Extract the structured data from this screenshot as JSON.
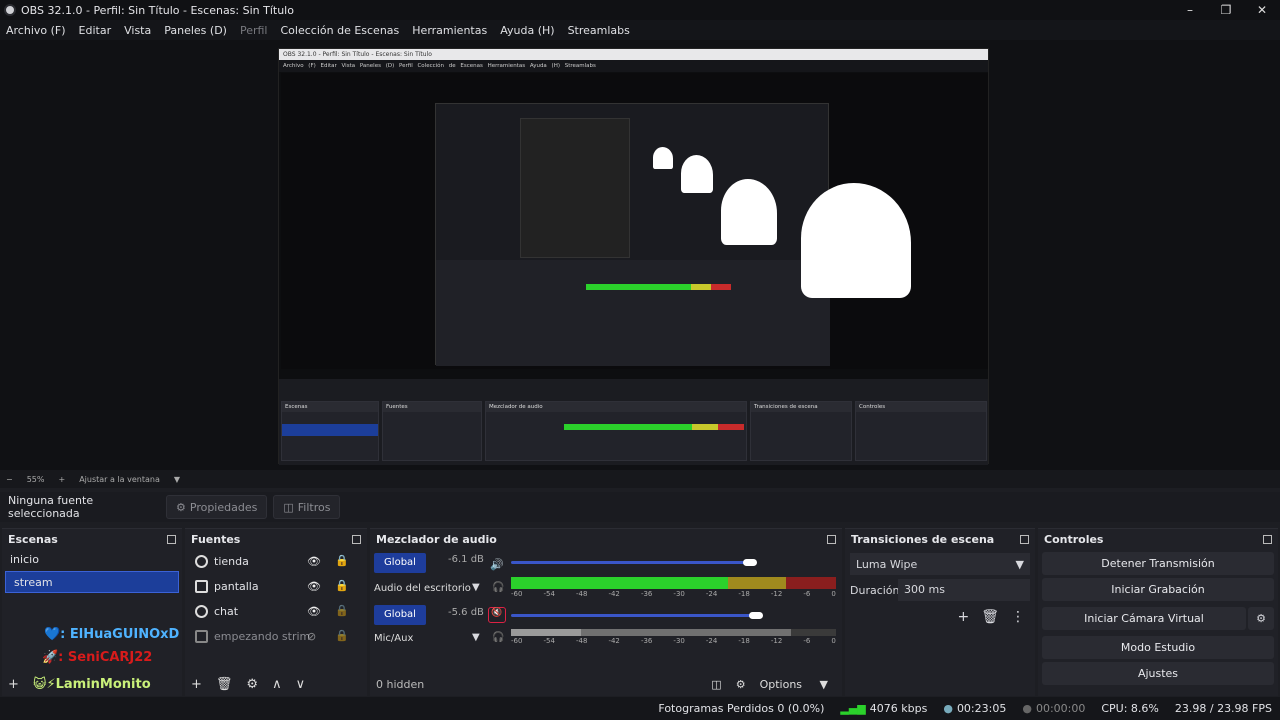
{
  "window": {
    "title": "OBS 32.1.0 - Perfil: Sin Título - Escenas: Sin Título",
    "minimize": "–",
    "maximize": "❐",
    "close": "✕"
  },
  "menu": [
    "Archivo (F)",
    "Editar",
    "Vista",
    "Paneles (D)",
    "Perfil",
    "Colección de Escenas",
    "Herramientas",
    "Ayuda (H)",
    "Streamlabs"
  ],
  "zoom": {
    "minus": "−",
    "value": "55%",
    "plus": "+",
    "fit_label": "Ajustar a la ventana"
  },
  "source_bar": {
    "no_selection": "Ninguna fuente seleccionada",
    "properties": "Propiedades",
    "filters": "Filtros"
  },
  "scenes": {
    "title": "Escenas",
    "items": [
      "inicio",
      "stream"
    ],
    "selected": "stream"
  },
  "chat_overlay": {
    "user1": "ElHuaGUINOxD",
    "user2": "SeniCARJ22",
    "user3": "LaminMonito"
  },
  "sources": {
    "title": "Fuentes",
    "items": [
      {
        "name": "tienda",
        "icon": "globe-icon"
      },
      {
        "name": "pantalla",
        "icon": "monitor-icon"
      },
      {
        "name": "chat",
        "icon": "globe-icon"
      },
      {
        "name": "empezando strim",
        "icon": "image-icon"
      }
    ]
  },
  "mixer": {
    "title": "Mezclador de audio",
    "hidden": "0 hidden",
    "options": "Options",
    "channels": [
      {
        "global": "Global",
        "db": "-6.1 dB",
        "name": "Audio del escritorio",
        "volume": 0.9,
        "muted": false
      },
      {
        "global": "Global",
        "db": "-5.6 dB",
        "name": "Mic/Aux",
        "volume": 0.92,
        "muted": true
      }
    ],
    "ticks": [
      "-60",
      "-54",
      "-48",
      "-42",
      "-36",
      "-30",
      "-24",
      "-18",
      "-12",
      "-6",
      "0"
    ]
  },
  "transitions": {
    "title": "Transiciones de escena",
    "selected": "Luma Wipe",
    "duration_label": "Duración",
    "duration_value": "300 ms"
  },
  "controls": {
    "title": "Controles",
    "buttons": [
      "Detener Transmisión",
      "Iniciar Grabación",
      "Iniciar Cámara Virtual",
      "Modo Estudio",
      "Ajustes"
    ]
  },
  "status": {
    "dropped": "Fotogramas Perdidos 0 (0.0%)",
    "bitrate": "4076 kbps",
    "stream_time": "00:23:05",
    "rec_time": "00:00:00",
    "cpu": "CPU: 8.6%",
    "fps": "23.98 / 23.98 FPS"
  },
  "colors": {
    "accent": "#1c3e9a",
    "meter_green": "#2bd12b",
    "meter_yellow": "#c8c82b",
    "meter_red": "#c82b2b"
  }
}
